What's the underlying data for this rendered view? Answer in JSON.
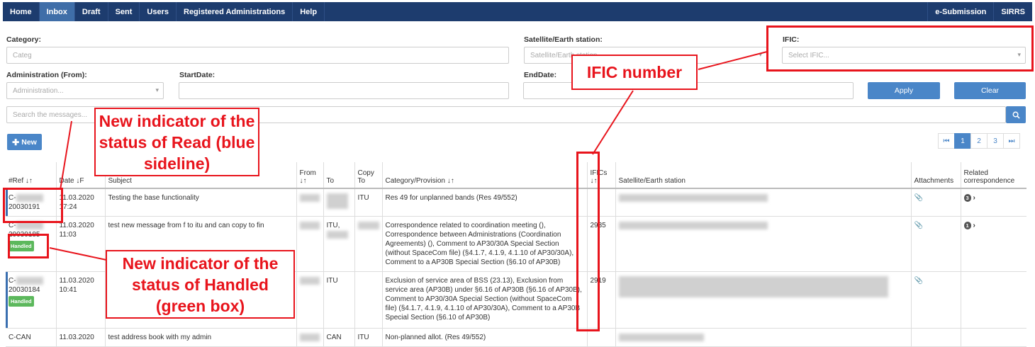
{
  "nav": {
    "items": [
      "Home",
      "Inbox",
      "Draft",
      "Sent",
      "Users",
      "Registered Administrations",
      "Help"
    ],
    "right": [
      "e-Submission",
      "SIRRS"
    ],
    "active": "Inbox"
  },
  "filters": {
    "category_label": "Category:",
    "category_placeholder": "Categ",
    "satellite_label": "Satellite/Earth station:",
    "satellite_placeholder": "Satellite/Earth station",
    "ific_label": "IFIC:",
    "ific_placeholder": "Select IFIC...",
    "admin_label": "Administration (From):",
    "admin_placeholder": "Administration...",
    "startdate_label": "StartDate:",
    "enddate_label": "EndDate:",
    "apply": "Apply",
    "clear": "Clear",
    "search_placeholder": "Search the messages..."
  },
  "new_button": "New",
  "pager": [
    "⏮",
    "1",
    "2",
    "3",
    "⏭"
  ],
  "table": {
    "headers": {
      "ref": "#Ref ↓↑",
      "date": "Date ↓F",
      "subject": "Subject",
      "from": "From ↓↑",
      "to": "To",
      "copyto": "Copy To",
      "category": "Category/Provision ↓↑",
      "ifics": "IFICs ↓↑",
      "satellite": "Satellite/Earth station",
      "attachments": "Attachments",
      "related": "Related correspondence"
    },
    "rows": [
      {
        "ref_prefix": "C-",
        "ref": "20030191",
        "date": "11.03.2020",
        "time": "17:24",
        "subject": "Testing the base functionality",
        "to": "",
        "copyto": "ITU",
        "category": "Res 49 for unplanned bands (Res 49/552)",
        "ific": "",
        "attachment": true,
        "related": "3",
        "handled": false
      },
      {
        "ref_prefix": "C-",
        "ref": "20030185",
        "date": "11.03.2020",
        "time": "11:03",
        "subject": "test new message from f to itu and can copy to fin",
        "to": "ITU,",
        "copyto": "",
        "category": "Correspondence related to coordination meeting (), Correspondence between Administrations (Coordination Agreements) (), Comment to AP30/30A Special Section (without SpaceCom file) (§4.1.7, 4.1.9, 4.1.10 of AP30/30A), Comment to a AP30B Special Section (§6.10 of AP30B)",
        "ific": "2935",
        "attachment": true,
        "related": "1",
        "handled": true
      },
      {
        "ref_prefix": "C-",
        "ref": "20030184",
        "date": "11.03.2020",
        "time": "10:41",
        "subject": "",
        "to": "ITU",
        "copyto": "",
        "category": "Exclusion of service area of BSS (23.13), Exclusion from service area (AP30B) under §6.16 of AP30B (§6.16 of AP30B), Comment to AP30/30A Special Section (without SpaceCom file) (§4.1.7, 4.1.9, 4.1.10 of AP30/30A), Comment to a AP30B Special Section (§6.10 of AP30B)",
        "ific": "2919",
        "attachment": true,
        "related": "",
        "handled": true
      },
      {
        "ref_prefix": "C-CAN",
        "ref": "",
        "date": "11.03.2020",
        "time": "",
        "subject": "test address book with my admin",
        "to": "CAN",
        "copyto": "ITU",
        "category": "Non-planned allot. (Res 49/552)",
        "ific": "",
        "attachment": false,
        "related": "",
        "handled": false
      }
    ],
    "handled_label": "Handled"
  },
  "annotations": {
    "read": "New indicator of the status of Read (blue sideline)",
    "handled": "New indicator of the status of Handled (green box)",
    "ific": "IFIC number"
  }
}
